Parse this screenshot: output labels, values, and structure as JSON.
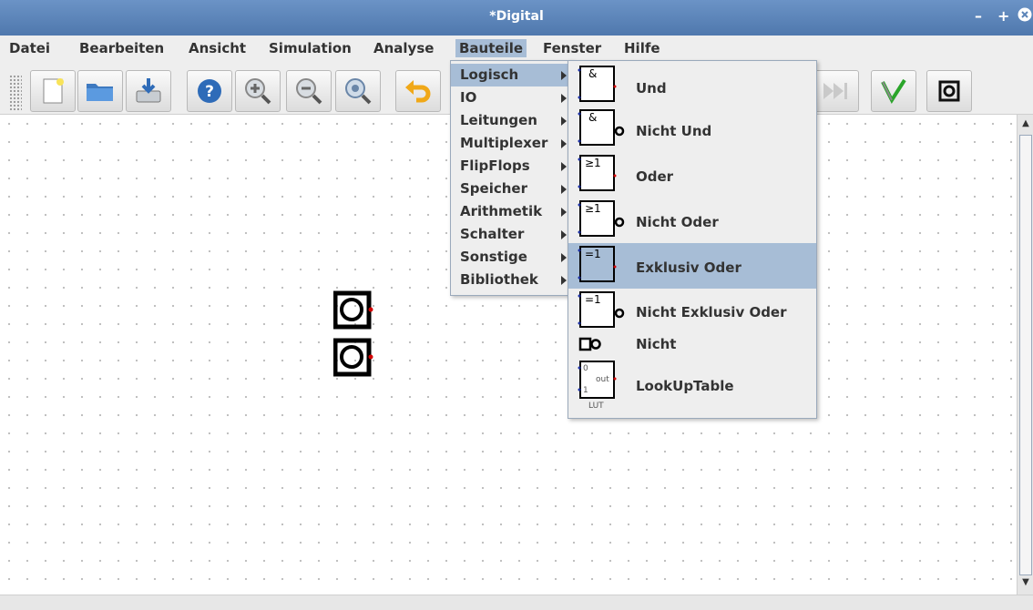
{
  "window": {
    "title": "*Digital"
  },
  "menubar": [
    "Datei",
    "Bearbeiten",
    "Ansicht",
    "Simulation",
    "Analyse",
    "Bauteile",
    "Fenster",
    "Hilfe"
  ],
  "bauteile_menu": [
    "Logisch",
    "IO",
    "Leitungen",
    "Multiplexer",
    "FlipFlops",
    "Speicher",
    "Arithmetik",
    "Schalter",
    "Sonstige",
    "Bibliothek"
  ],
  "logisch_submenu": [
    {
      "label": "Und",
      "symbol": "&"
    },
    {
      "label": "Nicht Und",
      "symbol": "&"
    },
    {
      "label": "Oder",
      "symbol": "≥1"
    },
    {
      "label": "Nicht Oder",
      "symbol": "≥1"
    },
    {
      "label": "Exklusiv Oder",
      "symbol": "=1"
    },
    {
      "label": "Nicht Exklusiv Oder",
      "symbol": "=1"
    },
    {
      "label": "Nicht",
      "symbol": ""
    },
    {
      "label": "LookUpTable",
      "symbol": ""
    }
  ],
  "lut_icon": {
    "in0": "0",
    "in1": "1",
    "out": "out",
    "name": "LUT"
  },
  "selected": {
    "menubar": "Bauteile",
    "bauteile_menu": "Logisch",
    "submenu": "Exklusiv Oder"
  },
  "colors": {
    "titlebar": "#5b84b8",
    "selection": "#a7bdd6",
    "pin_output": "#d40000",
    "pin_input": "#1a2ea0"
  }
}
